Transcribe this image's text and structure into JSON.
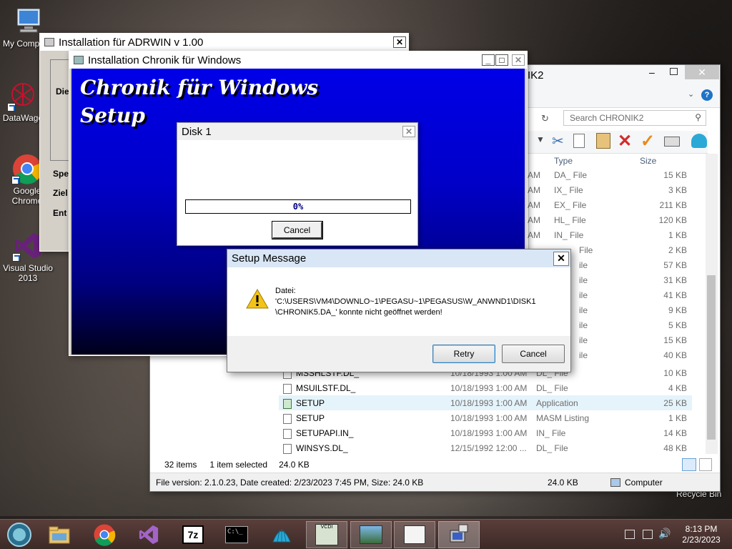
{
  "desktop": {
    "icons": [
      {
        "label": "My Computer",
        "icon": "computer-icon"
      },
      {
        "label": "DataWage",
        "icon": "datawage-icon"
      },
      {
        "label": "Google Chrome",
        "icon": "chrome-icon"
      },
      {
        "label": "Visual Studio 2013",
        "icon": "visual-studio-icon"
      }
    ],
    "recycle_bin_label": "Recycle Bin"
  },
  "explorer": {
    "title_fragment": "IK2",
    "search_placeholder": "Search CHRONIK2",
    "columns": {
      "type": "Type",
      "size": "Size"
    },
    "partial_rows": [
      {
        "date": "AM",
        "type": "DA_ File",
        "size": "15 KB"
      },
      {
        "date": "AM",
        "type": "IX_ File",
        "size": "3 KB"
      },
      {
        "date": "AM",
        "type": "EX_ File",
        "size": "211 KB"
      },
      {
        "date": "AM",
        "type": "HL_ File",
        "size": "120 KB"
      },
      {
        "date": "AM",
        "type": "IN_ File",
        "size": "1 KB"
      },
      {
        "type": "File",
        "size": "2 KB"
      },
      {
        "type": "ile",
        "size": "57 KB"
      },
      {
        "type": "ile",
        "size": "31 KB"
      },
      {
        "type": "ile",
        "size": "41 KB"
      },
      {
        "type": "ile",
        "size": "9 KB"
      },
      {
        "type": "ile",
        "size": "5 KB"
      },
      {
        "type": "ile",
        "size": "15 KB"
      },
      {
        "type": "ile",
        "size": "40 KB"
      }
    ],
    "rows": [
      {
        "name": "MSSHLSTF.DL_",
        "date": "10/18/1993 1:00 AM",
        "type": "DL_ File",
        "size": "10 KB"
      },
      {
        "name": "MSUILSTF.DL_",
        "date": "10/18/1993 1:00 AM",
        "type": "DL_ File",
        "size": "4 KB"
      },
      {
        "name": "SETUP",
        "date": "10/18/1993 1:00 AM",
        "type": "Application",
        "size": "25 KB",
        "selected": true
      },
      {
        "name": "SETUP",
        "date": "10/18/1993 1:00 AM",
        "type": "MASM Listing",
        "size": "1 KB"
      },
      {
        "name": "SETUPAPI.IN_",
        "date": "10/18/1993 1:00 AM",
        "type": "IN_ File",
        "size": "14 KB"
      },
      {
        "name": "WINSYS.DL_",
        "date": "12/15/1992 12:00 ...",
        "type": "DL_ File",
        "size": "48 KB"
      }
    ],
    "status": {
      "items": "32 items",
      "selected": "1 item selected",
      "size": "24.0 KB"
    },
    "details": {
      "info": "File version: 2.1.0.23, Date created: 2/23/2023 7:45 PM, Size: 24.0 KB",
      "size": "24.0 KB",
      "location": "Computer"
    }
  },
  "adrwin": {
    "title": "Installation für ADRWIN v 1.00",
    "labels": [
      "Die",
      "Spe",
      "Ziel",
      "Ent"
    ]
  },
  "chronik": {
    "title": "Installation Chronik für Windows",
    "heading_line1": "Chronik für Windows",
    "heading_line2": "Setup"
  },
  "disk_dialog": {
    "title": "Disk 1",
    "progress_text": "0%",
    "progress": 0,
    "cancel_label": "Cancel"
  },
  "setup_message": {
    "title": "Setup Message",
    "text": "Datei:\n'C:\\USERS\\VM4\\DOWNLO~1\\PEGASU~1\\PEGASUS\\W_ANWND1\\DISK1\n\\CHRONIK5.DA_' konnte nicht geöffnet werden!",
    "retry_label": "Retry",
    "cancel_label": "Cancel"
  },
  "taskbar": {
    "time": "8:13 PM",
    "date": "2/23/2023"
  }
}
